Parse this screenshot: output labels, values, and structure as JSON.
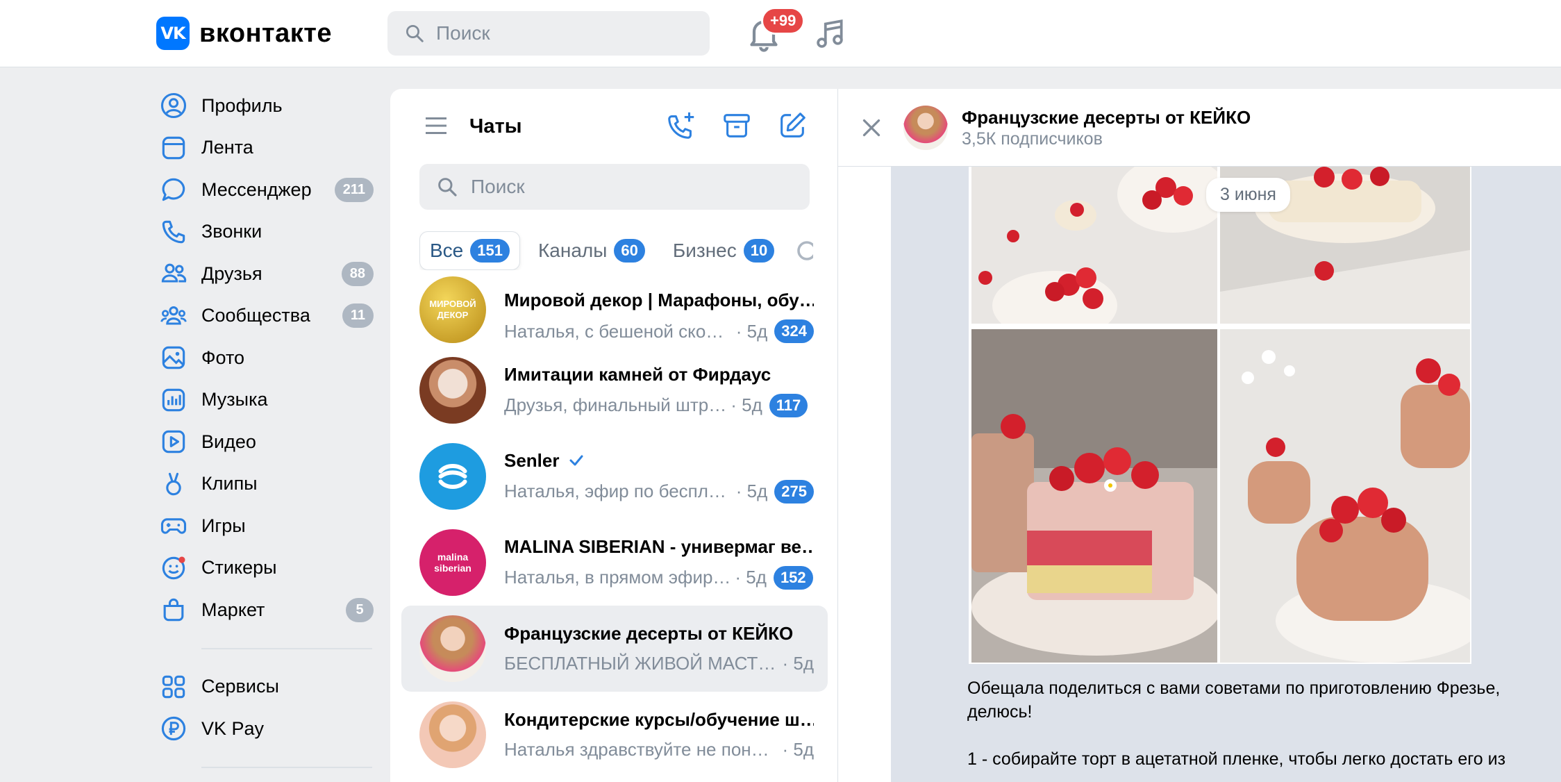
{
  "header": {
    "logo_mark": "VK",
    "logo_text": "вконтакте",
    "search_placeholder": "Поиск",
    "notifications_badge": "+99"
  },
  "nav": {
    "items": [
      {
        "label": "Профиль",
        "icon": "profile-icon",
        "count": ""
      },
      {
        "label": "Лента",
        "icon": "feed-icon",
        "count": ""
      },
      {
        "label": "Мессенджер",
        "icon": "messenger-icon",
        "count": "211"
      },
      {
        "label": "Звонки",
        "icon": "phone-icon",
        "count": ""
      },
      {
        "label": "Друзья",
        "icon": "friends-icon",
        "count": "88"
      },
      {
        "label": "Сообщества",
        "icon": "communities-icon",
        "count": "11"
      },
      {
        "label": "Фото",
        "icon": "photo-icon",
        "count": ""
      },
      {
        "label": "Музыка",
        "icon": "music-icon",
        "count": ""
      },
      {
        "label": "Видео",
        "icon": "video-icon",
        "count": ""
      },
      {
        "label": "Клипы",
        "icon": "clips-icon",
        "count": ""
      },
      {
        "label": "Игры",
        "icon": "games-icon",
        "count": ""
      },
      {
        "label": "Стикеры",
        "icon": "stickers-icon",
        "count": ""
      },
      {
        "label": "Маркет",
        "icon": "market-icon",
        "count": "5"
      }
    ],
    "secondary": [
      {
        "label": "Сервисы",
        "icon": "services-icon"
      },
      {
        "label": "VK Pay",
        "icon": "vkpay-icon"
      }
    ]
  },
  "chats": {
    "title": "Чаты",
    "search_placeholder": "Поиск",
    "tabs": [
      {
        "label": "Все",
        "count": "151"
      },
      {
        "label": "Каналы",
        "count": "60"
      },
      {
        "label": "Бизнес",
        "count": "10"
      }
    ],
    "list": [
      {
        "name": "Мировой декор | Марафоны, обу…",
        "preview": "Наталья, с бешеной скор…",
        "time": "· 5д",
        "unread": "324",
        "avatar_color": "#c9a227",
        "avatar_text": "МИРОВОЙ ДЕКОР"
      },
      {
        "name": "Имитации камней от Фирдаус",
        "preview": "Друзья, финальный штр…",
        "time": "· 5д",
        "unread": "117",
        "avatar_color": "#a0593f",
        "avatar_text": ""
      },
      {
        "name": "Senler",
        "preview": "Наталья, эфир по беспла…",
        "time": "· 5д",
        "unread": "275",
        "avatar_color": "#1e9ce0",
        "avatar_text": "",
        "verified": true
      },
      {
        "name": "MALINA SIBERIAN - универмаг ве…",
        "preview": "Наталья, в прямом эфир…",
        "time": "· 5д",
        "unread": "152",
        "avatar_color": "#d6216b",
        "avatar_text": "malina siberian"
      },
      {
        "name": "Французские десерты от КЕЙКО",
        "preview": "БЕСПЛАТНЫЙ ЖИВОЙ МАСТЕ…",
        "time": "· 5д",
        "unread": "",
        "avatar_color": "#c97b6b",
        "avatar_text": "",
        "selected": true
      },
      {
        "name": "Кондитерские курсы/обучение ш…",
        "preview": "Наталья здравствуйте не поня…",
        "time": "· 5д",
        "unread": "",
        "avatar_color": "#e8b5a0",
        "avatar_text": ""
      }
    ]
  },
  "conversation": {
    "title": "Французские десерты от КЕЙКО",
    "subtitle": "3,5К подписчиков",
    "date_pill": "3 июня",
    "message_lines": [
      "Обещала поделиться с вами советами по приготовлению Фрезье, делюсь!",
      "1 - собирайте торт в ацетатной пленке, чтобы легко достать его из"
    ]
  },
  "colors": {
    "accent": "#0077ff",
    "badge_blue": "#2d81e0",
    "badge_gray": "#aeb7c2",
    "badge_red": "#e64646"
  }
}
